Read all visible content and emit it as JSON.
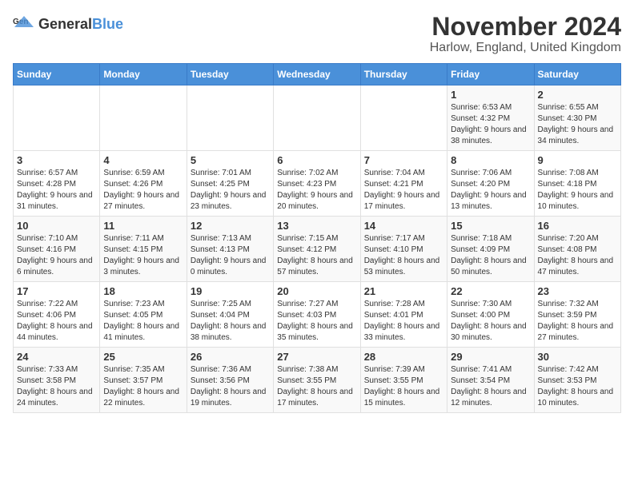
{
  "header": {
    "logo_general": "General",
    "logo_blue": "Blue",
    "month_title": "November 2024",
    "location": "Harlow, England, United Kingdom"
  },
  "weekdays": [
    "Sunday",
    "Monday",
    "Tuesday",
    "Wednesday",
    "Thursday",
    "Friday",
    "Saturday"
  ],
  "weeks": [
    [
      {
        "day": "",
        "info": ""
      },
      {
        "day": "",
        "info": ""
      },
      {
        "day": "",
        "info": ""
      },
      {
        "day": "",
        "info": ""
      },
      {
        "day": "",
        "info": ""
      },
      {
        "day": "1",
        "info": "Sunrise: 6:53 AM\nSunset: 4:32 PM\nDaylight: 9 hours and 38 minutes."
      },
      {
        "day": "2",
        "info": "Sunrise: 6:55 AM\nSunset: 4:30 PM\nDaylight: 9 hours and 34 minutes."
      }
    ],
    [
      {
        "day": "3",
        "info": "Sunrise: 6:57 AM\nSunset: 4:28 PM\nDaylight: 9 hours and 31 minutes."
      },
      {
        "day": "4",
        "info": "Sunrise: 6:59 AM\nSunset: 4:26 PM\nDaylight: 9 hours and 27 minutes."
      },
      {
        "day": "5",
        "info": "Sunrise: 7:01 AM\nSunset: 4:25 PM\nDaylight: 9 hours and 23 minutes."
      },
      {
        "day": "6",
        "info": "Sunrise: 7:02 AM\nSunset: 4:23 PM\nDaylight: 9 hours and 20 minutes."
      },
      {
        "day": "7",
        "info": "Sunrise: 7:04 AM\nSunset: 4:21 PM\nDaylight: 9 hours and 17 minutes."
      },
      {
        "day": "8",
        "info": "Sunrise: 7:06 AM\nSunset: 4:20 PM\nDaylight: 9 hours and 13 minutes."
      },
      {
        "day": "9",
        "info": "Sunrise: 7:08 AM\nSunset: 4:18 PM\nDaylight: 9 hours and 10 minutes."
      }
    ],
    [
      {
        "day": "10",
        "info": "Sunrise: 7:10 AM\nSunset: 4:16 PM\nDaylight: 9 hours and 6 minutes."
      },
      {
        "day": "11",
        "info": "Sunrise: 7:11 AM\nSunset: 4:15 PM\nDaylight: 9 hours and 3 minutes."
      },
      {
        "day": "12",
        "info": "Sunrise: 7:13 AM\nSunset: 4:13 PM\nDaylight: 9 hours and 0 minutes."
      },
      {
        "day": "13",
        "info": "Sunrise: 7:15 AM\nSunset: 4:12 PM\nDaylight: 8 hours and 57 minutes."
      },
      {
        "day": "14",
        "info": "Sunrise: 7:17 AM\nSunset: 4:10 PM\nDaylight: 8 hours and 53 minutes."
      },
      {
        "day": "15",
        "info": "Sunrise: 7:18 AM\nSunset: 4:09 PM\nDaylight: 8 hours and 50 minutes."
      },
      {
        "day": "16",
        "info": "Sunrise: 7:20 AM\nSunset: 4:08 PM\nDaylight: 8 hours and 47 minutes."
      }
    ],
    [
      {
        "day": "17",
        "info": "Sunrise: 7:22 AM\nSunset: 4:06 PM\nDaylight: 8 hours and 44 minutes."
      },
      {
        "day": "18",
        "info": "Sunrise: 7:23 AM\nSunset: 4:05 PM\nDaylight: 8 hours and 41 minutes."
      },
      {
        "day": "19",
        "info": "Sunrise: 7:25 AM\nSunset: 4:04 PM\nDaylight: 8 hours and 38 minutes."
      },
      {
        "day": "20",
        "info": "Sunrise: 7:27 AM\nSunset: 4:03 PM\nDaylight: 8 hours and 35 minutes."
      },
      {
        "day": "21",
        "info": "Sunrise: 7:28 AM\nSunset: 4:01 PM\nDaylight: 8 hours and 33 minutes."
      },
      {
        "day": "22",
        "info": "Sunrise: 7:30 AM\nSunset: 4:00 PM\nDaylight: 8 hours and 30 minutes."
      },
      {
        "day": "23",
        "info": "Sunrise: 7:32 AM\nSunset: 3:59 PM\nDaylight: 8 hours and 27 minutes."
      }
    ],
    [
      {
        "day": "24",
        "info": "Sunrise: 7:33 AM\nSunset: 3:58 PM\nDaylight: 8 hours and 24 minutes."
      },
      {
        "day": "25",
        "info": "Sunrise: 7:35 AM\nSunset: 3:57 PM\nDaylight: 8 hours and 22 minutes."
      },
      {
        "day": "26",
        "info": "Sunrise: 7:36 AM\nSunset: 3:56 PM\nDaylight: 8 hours and 19 minutes."
      },
      {
        "day": "27",
        "info": "Sunrise: 7:38 AM\nSunset: 3:55 PM\nDaylight: 8 hours and 17 minutes."
      },
      {
        "day": "28",
        "info": "Sunrise: 7:39 AM\nSunset: 3:55 PM\nDaylight: 8 hours and 15 minutes."
      },
      {
        "day": "29",
        "info": "Sunrise: 7:41 AM\nSunset: 3:54 PM\nDaylight: 8 hours and 12 minutes."
      },
      {
        "day": "30",
        "info": "Sunrise: 7:42 AM\nSunset: 3:53 PM\nDaylight: 8 hours and 10 minutes."
      }
    ]
  ]
}
